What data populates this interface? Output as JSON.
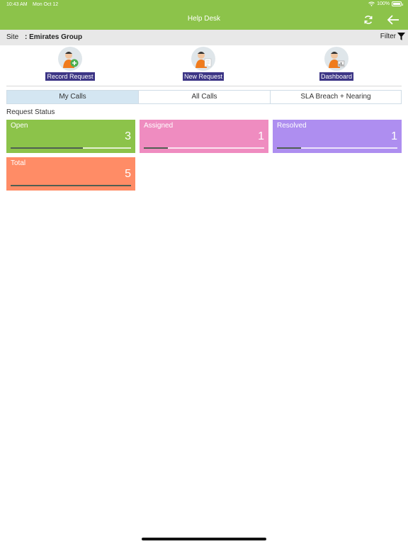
{
  "status_bar": {
    "time": "10:43 AM",
    "date": "Mon Oct 12",
    "battery": "100%"
  },
  "header": {
    "title": "Help Desk",
    "refresh_icon": "refresh-icon",
    "back_icon": "back-arrow-icon"
  },
  "site": {
    "label": "Site",
    "value": ": Emirates Group",
    "filter_label": "Filter",
    "filter_icon": "funnel-icon"
  },
  "actions": [
    {
      "label": "Record Request",
      "icon": "person-plus-icon"
    },
    {
      "label": "New Request",
      "icon": "person-doc-icon"
    },
    {
      "label": "Dashboard",
      "icon": "person-chart-icon"
    }
  ],
  "tabs": [
    {
      "label": "My Calls",
      "active": true
    },
    {
      "label": "All Calls",
      "active": false
    },
    {
      "label": "SLA Breach + Nearing",
      "active": false
    }
  ],
  "request_status": {
    "title": "Request Status",
    "cards": [
      {
        "label": "Open",
        "value": "3",
        "color": "#8cc34a",
        "progress": 0.6
      },
      {
        "label": "Assigned",
        "value": "1",
        "color": "#ef8cc0",
        "progress": 0.2
      },
      {
        "label": "Resolved",
        "value": "1",
        "color": "#ae8ef0",
        "progress": 0.2
      },
      {
        "label": "Total",
        "value": "5",
        "color": "#ff8c66",
        "progress": 1.0
      }
    ]
  },
  "colors": {
    "accent": "#8cc34a",
    "label_bg": "#3c3585",
    "active_tab": "#d4e6f2"
  }
}
